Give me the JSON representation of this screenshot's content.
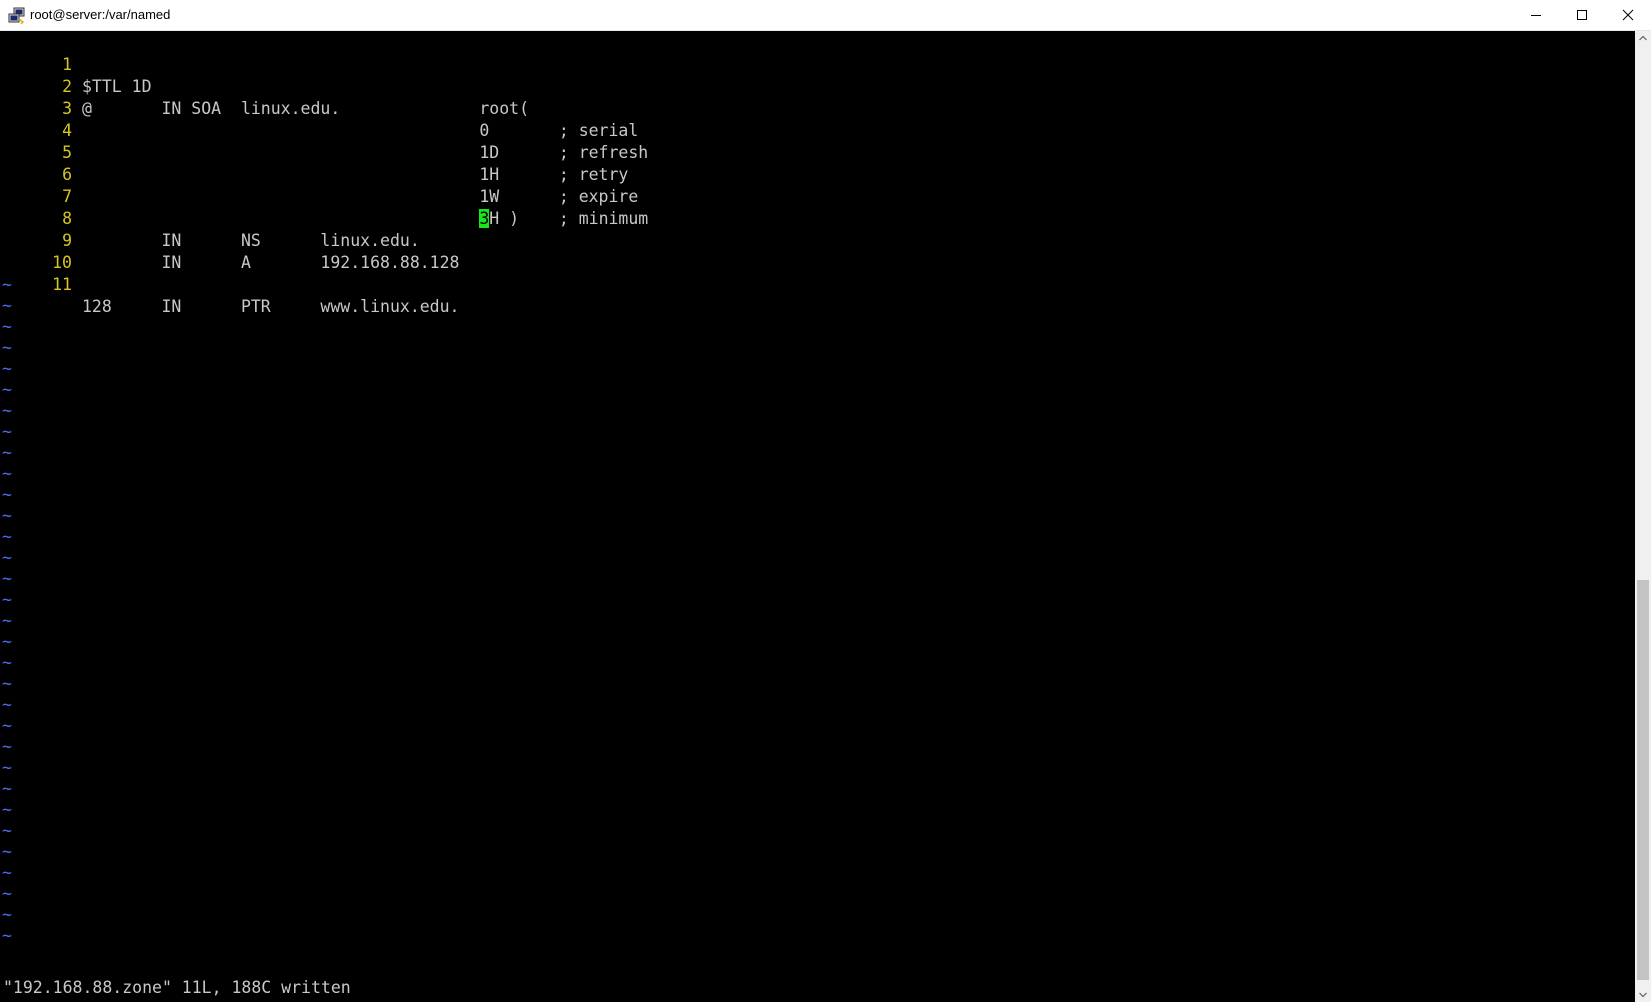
{
  "window": {
    "title": "root@server:/var/named",
    "icon": "putty-icon",
    "controls": [
      "minimize-icon",
      "maximize-icon",
      "close-icon"
    ]
  },
  "editor": {
    "lines": [
      {
        "num": "1",
        "text": "$TTL 1D"
      },
      {
        "num": "2",
        "text": "@       IN SOA  linux.edu.              root("
      },
      {
        "num": "3",
        "text": "                                        0       ; serial"
      },
      {
        "num": "4",
        "text": "                                        1D      ; refresh"
      },
      {
        "num": "5",
        "text": "                                        1H      ; retry"
      },
      {
        "num": "6",
        "text": "                                        1W      ; expire"
      },
      {
        "num": "7",
        "text_before": "                                        ",
        "cursor_char": "3",
        "text_after": "H )    ; minimum"
      },
      {
        "num": "8",
        "text": "        IN      NS      linux.edu."
      },
      {
        "num": "9",
        "text": "        IN      A       192.168.88.128"
      },
      {
        "num": "10",
        "text": ""
      },
      {
        "num": "11",
        "text": "128     IN      PTR     www.linux.edu."
      }
    ],
    "empty_line_marker": "~",
    "status": "\"192.168.88.zone\" 11L, 188C written"
  },
  "colors": {
    "background": "#000000",
    "text": "#c8c8c8",
    "line_number": "#d6c51f",
    "tilde": "#4e6cf2",
    "cursor": "#19e619"
  }
}
